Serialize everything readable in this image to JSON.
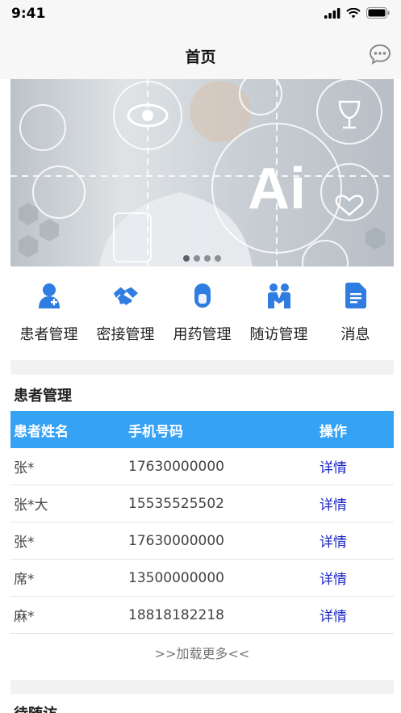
{
  "status_bar": {
    "time": "9:41"
  },
  "nav": {
    "title": "首页",
    "chat_icon": "chat-bubble-icon"
  },
  "banner": {
    "text": "Ai",
    "slide_count": 4,
    "active_index": 0
  },
  "quick_menu": [
    {
      "label": "患者管理",
      "icon": "patient-icon"
    },
    {
      "label": "密接管理",
      "icon": "handshake-icon"
    },
    {
      "label": "用药管理",
      "icon": "pill-icon"
    },
    {
      "label": "随访管理",
      "icon": "people-icon"
    },
    {
      "label": "消息",
      "icon": "document-icon"
    }
  ],
  "patients": {
    "title": "患者管理",
    "columns": [
      "患者姓名",
      "手机号码",
      "操作"
    ],
    "rows": [
      {
        "name": "张*",
        "phone": "17630000000",
        "action": "详情"
      },
      {
        "name": "张*大",
        "phone": "15535525502",
        "action": "详情"
      },
      {
        "name": "张*",
        "phone": "17630000000",
        "action": "详情"
      },
      {
        "name": "席*",
        "phone": "13500000000",
        "action": "详情"
      },
      {
        "name": "麻*",
        "phone": "18818182218",
        "action": "详情"
      }
    ],
    "load_more": ">>加载更多<<"
  },
  "next_section": {
    "title": "待随访"
  },
  "colors": {
    "accent": "#36a2f6",
    "icon_blue": "#2f7de1",
    "link": "#1c28c6"
  }
}
